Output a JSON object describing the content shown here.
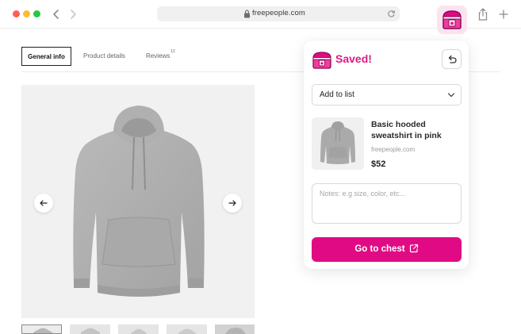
{
  "browser": {
    "url": "freepeople.com",
    "icons": {
      "back": "chevron-left-icon",
      "forward": "chevron-right-icon",
      "lock": "lock-icon",
      "reload": "reload-icon",
      "share": "share-icon",
      "new_tab": "plus-icon",
      "extension": "treasure-chest-icon"
    }
  },
  "product_page": {
    "tabs": [
      {
        "label": "General info",
        "active": true
      },
      {
        "label": "Product details",
        "active": false
      },
      {
        "label": "Reviews",
        "badge": "12",
        "active": false
      }
    ],
    "gallery": {
      "prev_icon": "arrow-left-icon",
      "next_icon": "arrow-right-icon",
      "thumbnail_count": 5,
      "selected_thumbnail": 1
    }
  },
  "popup": {
    "status": "Saved!",
    "list_select": {
      "label": "Add to list"
    },
    "item": {
      "name": "Basic hooded sweatshirt in pink",
      "domain": "freepeople.com",
      "price": "$52"
    },
    "notes": {
      "placeholder": "Notes: e.g size, color, etc...",
      "value": ""
    },
    "cta_label": "Go to chest",
    "colors": {
      "accent": "#e00b84",
      "accent_light": "#fce3f0",
      "title": "#dd1a82"
    }
  }
}
